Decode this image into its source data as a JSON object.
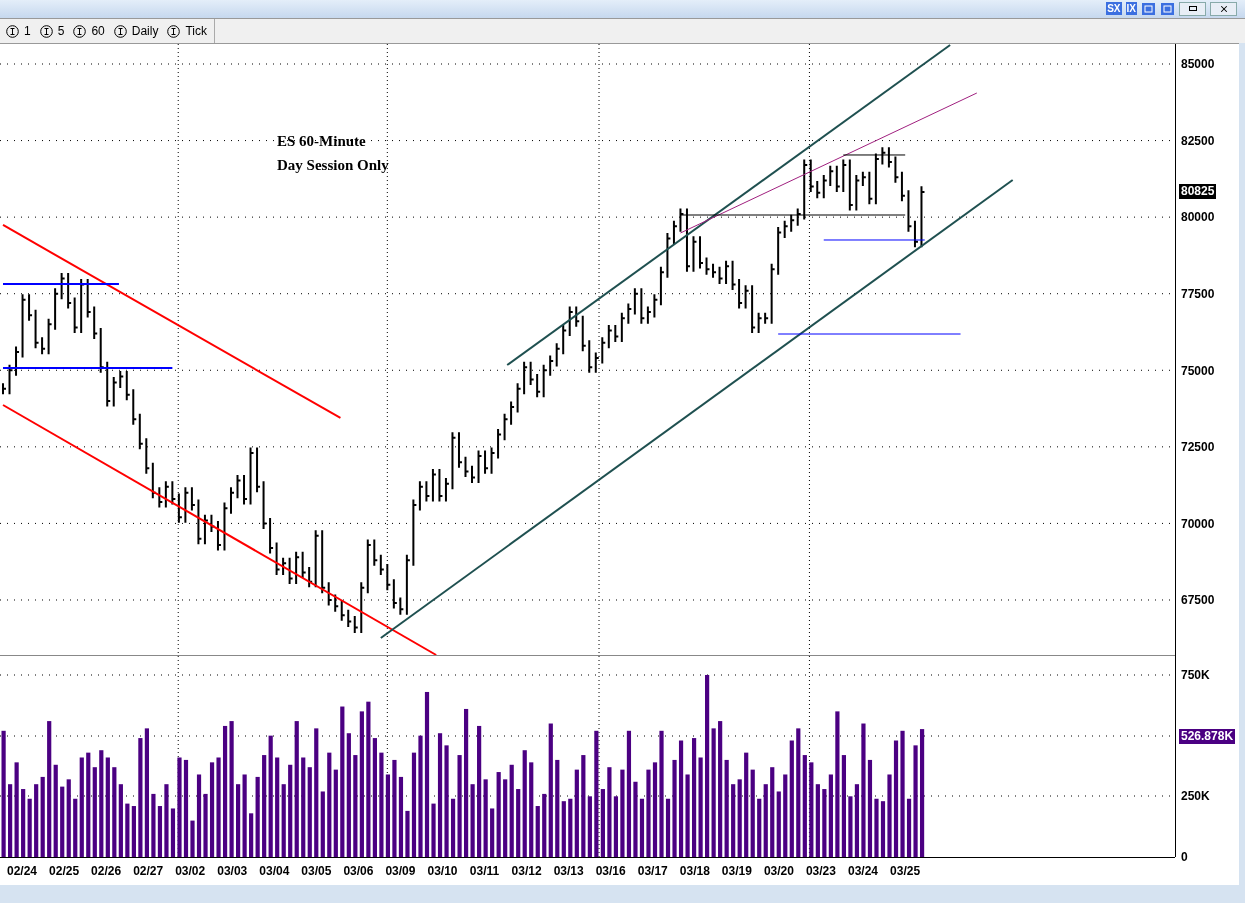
{
  "toolbar": [
    {
      "label": "1"
    },
    {
      "label": "5"
    },
    {
      "label": "60"
    },
    {
      "label": "Daily"
    },
    {
      "label": "Tick"
    }
  ],
  "window_buttons": [
    {
      "label": "SX"
    },
    {
      "label": "IX"
    }
  ],
  "notes": [
    "ES 60-Minute",
    "Day Session Only"
  ],
  "price_panel": {
    "axis_labels": [
      "85000",
      "82500",
      "80000",
      "77500",
      "75000",
      "72500",
      "70000",
      "67500"
    ],
    "last_value": "80825"
  },
  "volume_panel": {
    "axis_labels": [
      "750K",
      "250K",
      "0"
    ],
    "last_value": "526.878K"
  },
  "dates": [
    "02/24",
    "02/25",
    "02/26",
    "02/27",
    "03/02",
    "03/03",
    "03/04",
    "03/05",
    "03/06",
    "03/09",
    "03/10",
    "03/11",
    "03/12",
    "03/13",
    "03/16",
    "03/17",
    "03/18",
    "03/19",
    "03/20",
    "03/23",
    "03/24",
    "03/25"
  ]
}
